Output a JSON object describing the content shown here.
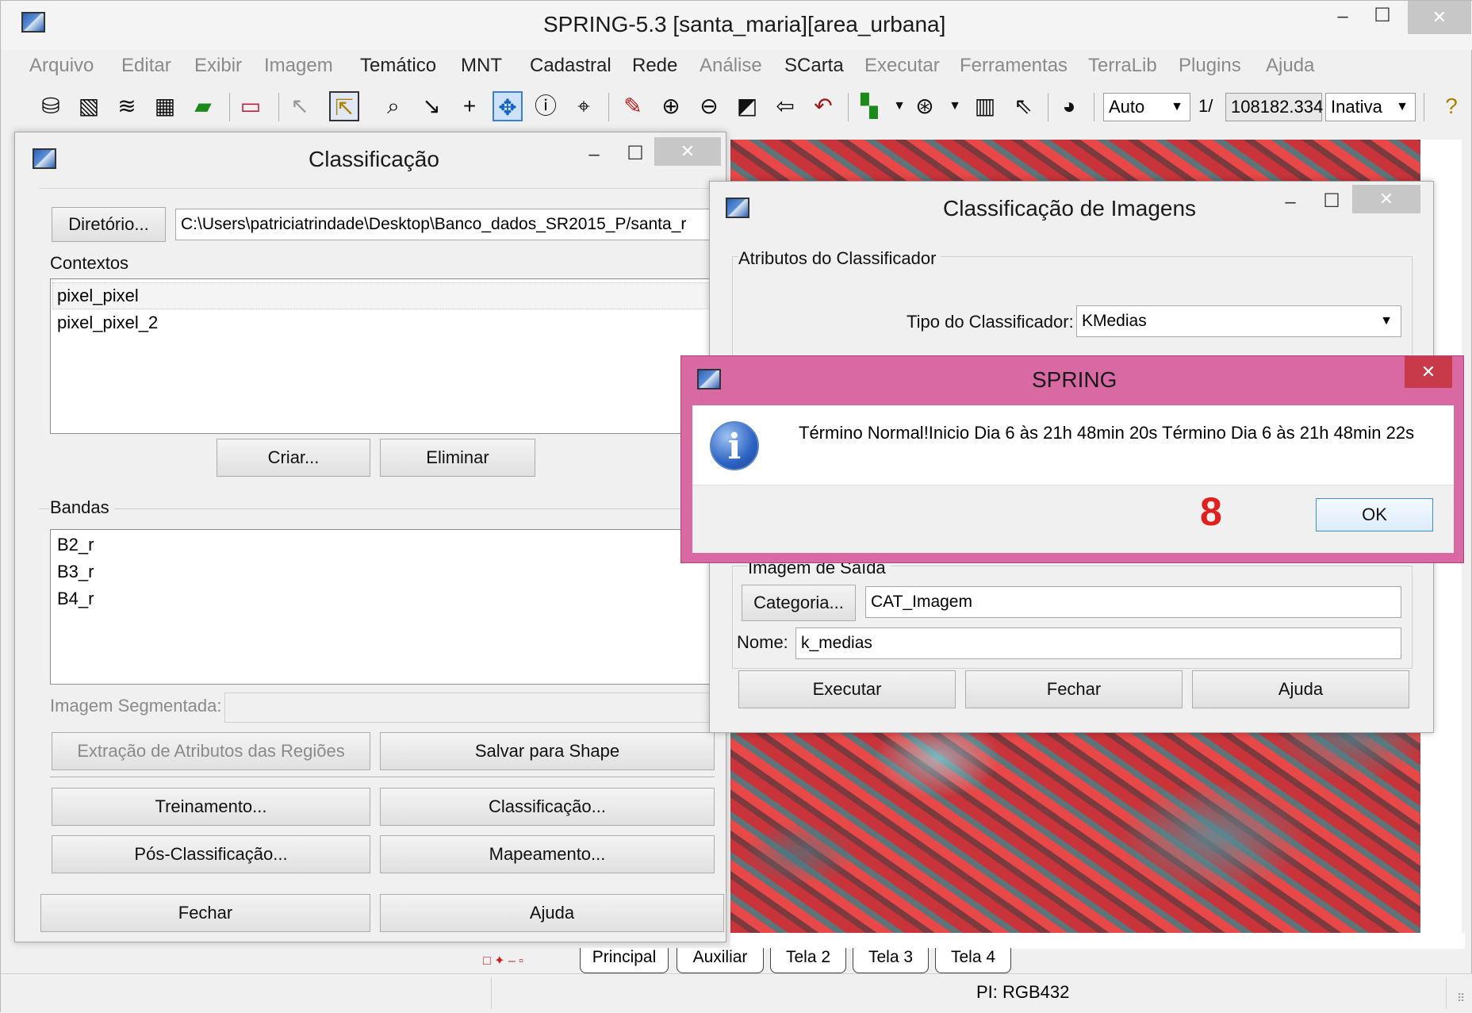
{
  "window": {
    "title": "SPRING-5.3 [santa_maria][area_urbana]",
    "minimize": "–",
    "maximize": "☐",
    "close": "✕"
  },
  "menu": [
    {
      "label": "Arquivo",
      "enabled": false
    },
    {
      "label": "Editar",
      "enabled": false
    },
    {
      "label": "Exibir",
      "enabled": false
    },
    {
      "label": "Imagem",
      "enabled": false
    },
    {
      "label": "Temático",
      "enabled": true
    },
    {
      "label": "MNT",
      "enabled": true
    },
    {
      "label": "Cadastral",
      "enabled": true
    },
    {
      "label": "Rede",
      "enabled": true
    },
    {
      "label": "Análise",
      "enabled": false
    },
    {
      "label": "SCarta",
      "enabled": true
    },
    {
      "label": "Executar",
      "enabled": false
    },
    {
      "label": "Ferramentas",
      "enabled": false
    },
    {
      "label": "TerraLib",
      "enabled": false
    },
    {
      "label": "Plugins",
      "enabled": false
    },
    {
      "label": "Ajuda",
      "enabled": false
    }
  ],
  "toolbar": {
    "zoom_mode": "Auto",
    "scale_prefix": "1/",
    "scale_value": "108182.334",
    "status_mode": "Inativa",
    "icons": [
      "database-icon",
      "layers-icon",
      "stack-icon",
      "grid-icon",
      "polygon-icon",
      "rectangle-icon",
      "cursor-disabled-icon",
      "measure-icon",
      "magnifier-icon",
      "arrow-down-right-icon",
      "plus-icon",
      "pan-icon",
      "info-icon",
      "tag-icon",
      "pencil-icon",
      "zoom-in-icon",
      "zoom-out-icon",
      "zoom-area-icon",
      "back-arrow-icon",
      "undo-icon",
      "map-icon",
      "zoom-scale-icon",
      "table-icon",
      "select-icon",
      "palette-icon",
      "help-icon"
    ]
  },
  "classificacao": {
    "title": "Classificação",
    "diretorio_button": "Diretório...",
    "diretorio_path": "C:\\Users\\patriciatrindade\\Desktop\\Banco_dados_SR2015_P/santa_r",
    "contextos_label": "Contextos",
    "contextos": [
      "pixel_pixel",
      "pixel_pixel_2"
    ],
    "criar_button": "Criar...",
    "eliminar_button": "Eliminar",
    "bandas_label": "Bandas",
    "bandas": [
      "B2_r",
      "B3_r",
      "B4_r"
    ],
    "imagem_segmentada_label": "Imagem Segmentada:",
    "imagem_segmentada_value": "",
    "extracao_button": "Extração de Atributos das Regiões",
    "salvar_shape_button": "Salvar para Shape",
    "treinamento_button": "Treinamento...",
    "classificacao_button": "Classificação...",
    "pos_classificacao_button": "Pós-Classificação...",
    "mapeamento_button": "Mapeamento...",
    "fechar_button": "Fechar",
    "ajuda_button": "Ajuda"
  },
  "classificacao_imagens": {
    "title": "Classificação de Imagens",
    "atributos_label": "Atributos do Classificador",
    "tipo_label": "Tipo do Classificador:",
    "tipo_value": "KMedias",
    "imagem_saida_label": "Imagem de Saída",
    "categoria_button": "Categoria...",
    "categoria_value": "CAT_Imagem",
    "nome_label": "Nome:",
    "nome_value": "k_medias",
    "executar_button": "Executar",
    "fechar_button": "Fechar",
    "ajuda_button": "Ajuda"
  },
  "message": {
    "title": "SPRING",
    "text": "Término Normal!Inicio Dia 6 às 21h 48min 20s Término Dia 6 às 21h 48min 22s",
    "annotation": "8",
    "annotation_color": "#e0201c",
    "ok_button": "OK"
  },
  "tabs": [
    "Principal",
    "Auxiliar",
    "Tela 2",
    "Tela 3",
    "Tela 4"
  ],
  "status": {
    "pi": "PI: RGB432"
  }
}
